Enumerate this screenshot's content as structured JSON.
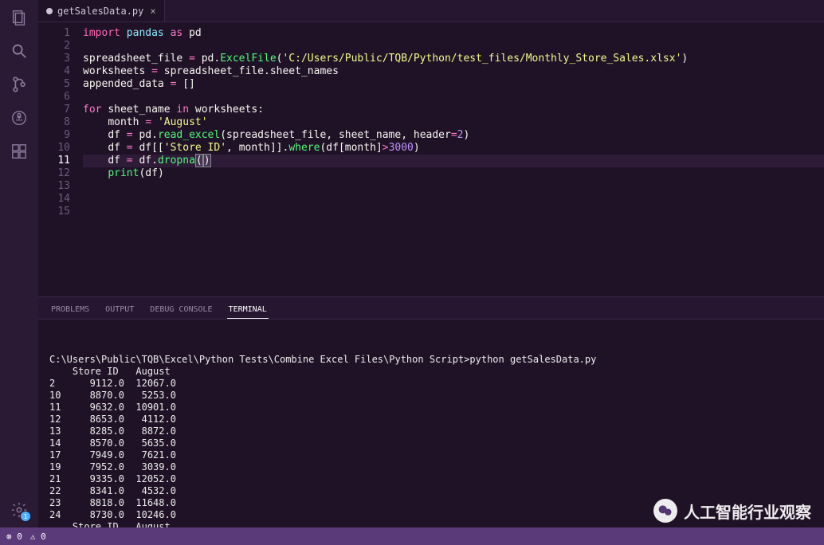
{
  "tab": {
    "filename": "getSalesData.py"
  },
  "code": {
    "line1_import": "import",
    "line1_pandas": "pandas",
    "line1_as": "as",
    "line1_pd": "pd",
    "excelFileCall": "ExcelFile",
    "path": "'C:/Users/Public/TQB/Python/test_files/Monthly_Store_Sales.xlsx'",
    "augStr": "'August'",
    "readExcel": "read_excel",
    "storeIdStr": "'Store ID'",
    "threeThousand": "3000",
    "two": "2"
  },
  "panel": {
    "tabs": {
      "problems": "PROBLEMS",
      "output": "OUTPUT",
      "debug": "DEBUG CONSOLE",
      "terminal": "TERMINAL"
    }
  },
  "terminal": {
    "prompt": "C:\\Users\\Public\\TQB\\Excel\\Python Tests\\Combine Excel Files\\Python Script>python getSalesData.py",
    "header": "    Store ID   August",
    "rows": [
      "2      9112.0  12067.0",
      "10     8870.0   5253.0",
      "11     9632.0  10901.0",
      "12     8653.0   4112.0",
      "13     8285.0   8872.0",
      "14     8570.0   5635.0",
      "17     7949.0   7621.0",
      "19     7952.0   3039.0",
      "21     9335.0  12052.0",
      "22     8341.0   4532.0",
      "23     8818.0  11648.0",
      "24     8730.0  10246.0"
    ],
    "footer": "    Store ID   August"
  },
  "statusbar": {
    "errors": "0",
    "warnings": "0"
  },
  "watermark": {
    "text": "人工智能行业观察"
  }
}
